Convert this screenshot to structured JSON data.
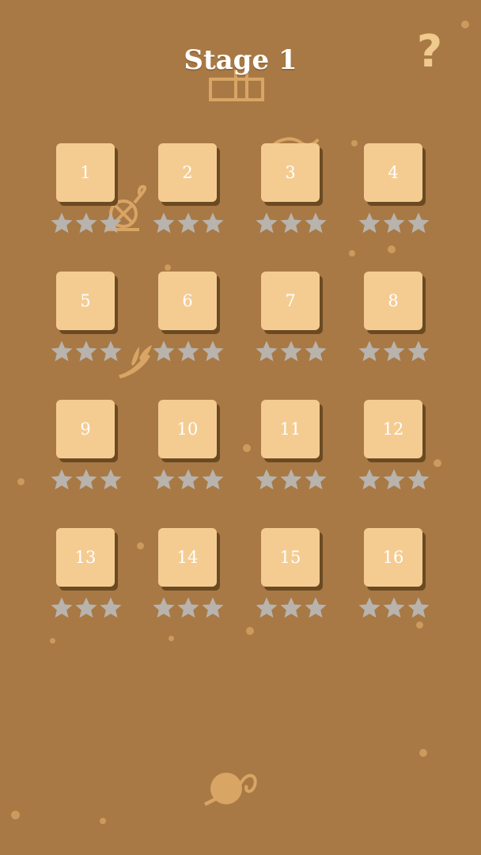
{
  "header": {
    "title": "Stage 1"
  },
  "help_button": {
    "label": "?"
  },
  "colors": {
    "background": "#a87945",
    "tile": "#f4cc92",
    "tile_shadow": "#6b4a22",
    "star_empty": "#b8b3ad",
    "decoration": "#d8a565"
  },
  "levels": [
    {
      "number": "1",
      "stars": 0
    },
    {
      "number": "2",
      "stars": 0
    },
    {
      "number": "3",
      "stars": 0
    },
    {
      "number": "4",
      "stars": 0
    },
    {
      "number": "5",
      "stars": 0
    },
    {
      "number": "6",
      "stars": 0
    },
    {
      "number": "7",
      "stars": 0
    },
    {
      "number": "8",
      "stars": 0
    },
    {
      "number": "9",
      "stars": 0
    },
    {
      "number": "10",
      "stars": 0
    },
    {
      "number": "11",
      "stars": 0
    },
    {
      "number": "12",
      "stars": 0
    },
    {
      "number": "13",
      "stars": 0
    },
    {
      "number": "14",
      "stars": 0
    },
    {
      "number": "15",
      "stars": 0
    },
    {
      "number": "16",
      "stars": 0
    }
  ]
}
